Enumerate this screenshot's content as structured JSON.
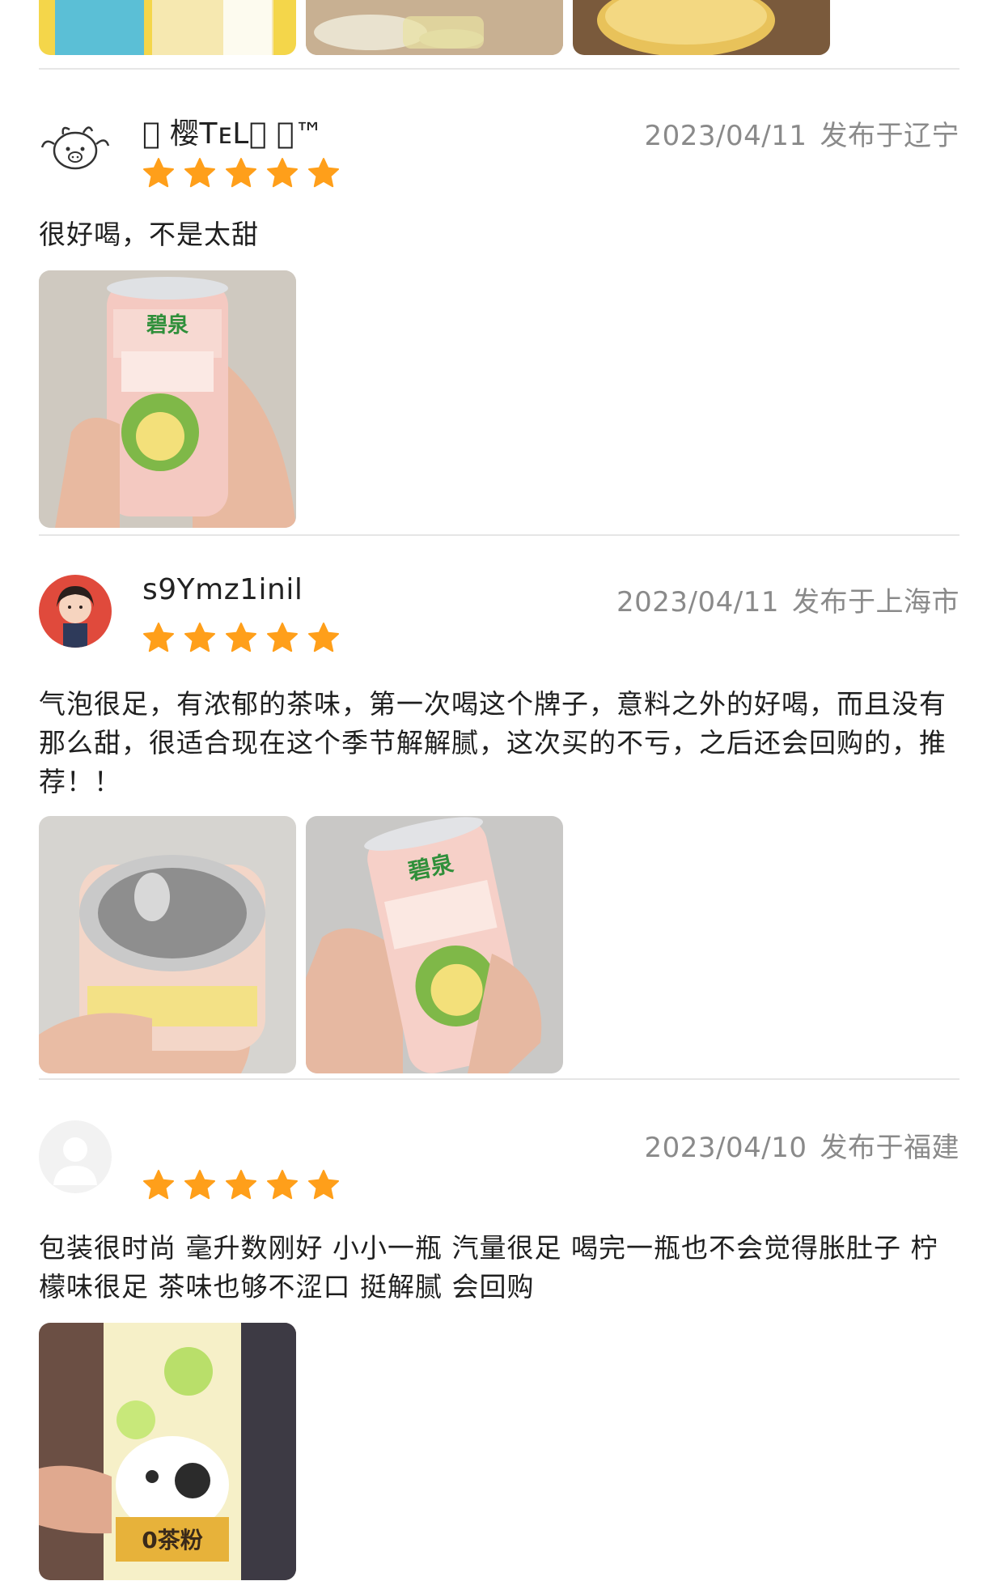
{
  "reviews": [
    {
      "username": " 樱TᴇL ™",
      "date": "2023/04/11",
      "location": "发布于辽宁",
      "rating": 5,
      "text": "很好喝，不是太甜",
      "photo_count": 1
    },
    {
      "username": "s9Ymz1inil",
      "date": "2023/04/11",
      "location": "发布于上海市",
      "rating": 5,
      "text": "气泡很足，有浓郁的茶味，第一次喝这个牌子，意料之外的好喝，而且没有那么甜，很适合现在这个季节解解腻，这次买的不亏，之后还会回购的，推荐！！",
      "photo_count": 2
    },
    {
      "username": "",
      "date": "2023/04/10",
      "location": "发布于福建",
      "rating": 5,
      "text": "包装很时尚  毫升数刚好 小小一瓶 汽量很足 喝完一瓶也不会觉得胀肚子 柠檬味很足 茶味也够不涩口  挺解腻 会回购",
      "photo_count": 1
    }
  ],
  "colors": {
    "star": "#FF9F1A",
    "meta_text": "#8a8a8a",
    "divider": "#e6e6e6"
  }
}
